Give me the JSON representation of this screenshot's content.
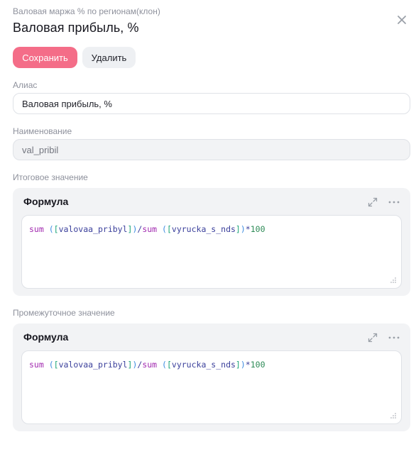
{
  "header": {
    "breadcrumb": "Валовая маржа % по регионам(клон)",
    "title": "Валовая прибыль, %"
  },
  "toolbar": {
    "save_label": "Сохранить",
    "delete_label": "Удалить"
  },
  "fields": {
    "alias_label": "Алиас",
    "alias_value": "Валовая прибыль, %",
    "name_label": "Наименование",
    "name_value": "val_pribil"
  },
  "sections": {
    "total": {
      "label": "Итоговое значение",
      "panel_title": "Формула",
      "formula": {
        "fn1": "sum",
        "open1": " (",
        "lb1": "[",
        "id1": "valovaa_pribyl",
        "rb1": "]",
        "close1": ")",
        "div": "/",
        "fn2": "sum",
        "open2": " (",
        "lb2": "[",
        "id2": "vyrucka_s_nds",
        "rb2": "]",
        "close2": ")",
        "mul": "*",
        "num": "100"
      }
    },
    "intermediate": {
      "label": "Промежуточное значение",
      "panel_title": "Формула",
      "formula": {
        "fn1": "sum",
        "open1": " (",
        "lb1": "[",
        "id1": "valovaa_pribyl",
        "rb1": "]",
        "close1": ")",
        "div": "/",
        "fn2": "sum",
        "open2": " (",
        "lb2": "[",
        "id2": "vyrucka_s_nds",
        "rb2": "]",
        "close2": ")",
        "mul": "*",
        "num": "100"
      }
    }
  },
  "icons": {
    "close": "close-icon",
    "expand": "expand-icon",
    "more": "more-icon",
    "resize": "resize-handle-icon"
  },
  "colors": {
    "primary": "#f46d88",
    "secondary_button": "#eef0f3",
    "panel_bg": "#f2f3f5",
    "code_function": "#a22bb0",
    "code_bracket_round": "#3d8ce0",
    "code_bracket_square": "#20a67a",
    "code_identifier": "#3a3f9b",
    "code_number": "#2e8b57"
  }
}
